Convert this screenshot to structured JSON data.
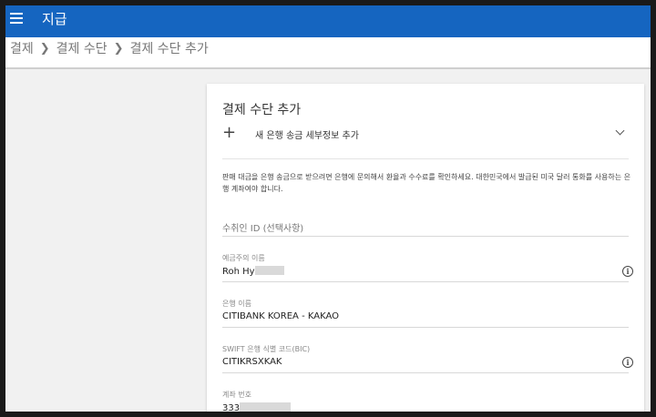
{
  "topbar": {
    "title": "지급"
  },
  "breadcrumb": [
    "결제",
    "결제 수단",
    "결제 수단 추가"
  ],
  "card": {
    "title": "결제 수단 추가",
    "add_bank_label": "새 은행 송금 세부정보 추가",
    "help_text": "판매 대금을 은행 송금으로 받으려면 은행에 문의해서 환율과 수수료를 확인하세요. 대한민국에서 발급된 미국 달러 통화를 사용하는 은행 계좌여야 합니다.",
    "payee_id_placeholder": "수취인 ID (선택사항)",
    "account_holder": {
      "label": "예금주의 이름",
      "value": "Roh Hy"
    },
    "bank_name": {
      "label": "은행 이름",
      "value": "CITIBANK KOREA - KAKAO"
    },
    "swift": {
      "label": "SWIFT 은행 식별 코드(BIC)",
      "value": "CITIKRSXKAK"
    },
    "account_number": {
      "label": "계좌 번호",
      "value": "333"
    }
  },
  "colors": {
    "appbar": "#1565c0",
    "background": "#f1f1f1"
  }
}
